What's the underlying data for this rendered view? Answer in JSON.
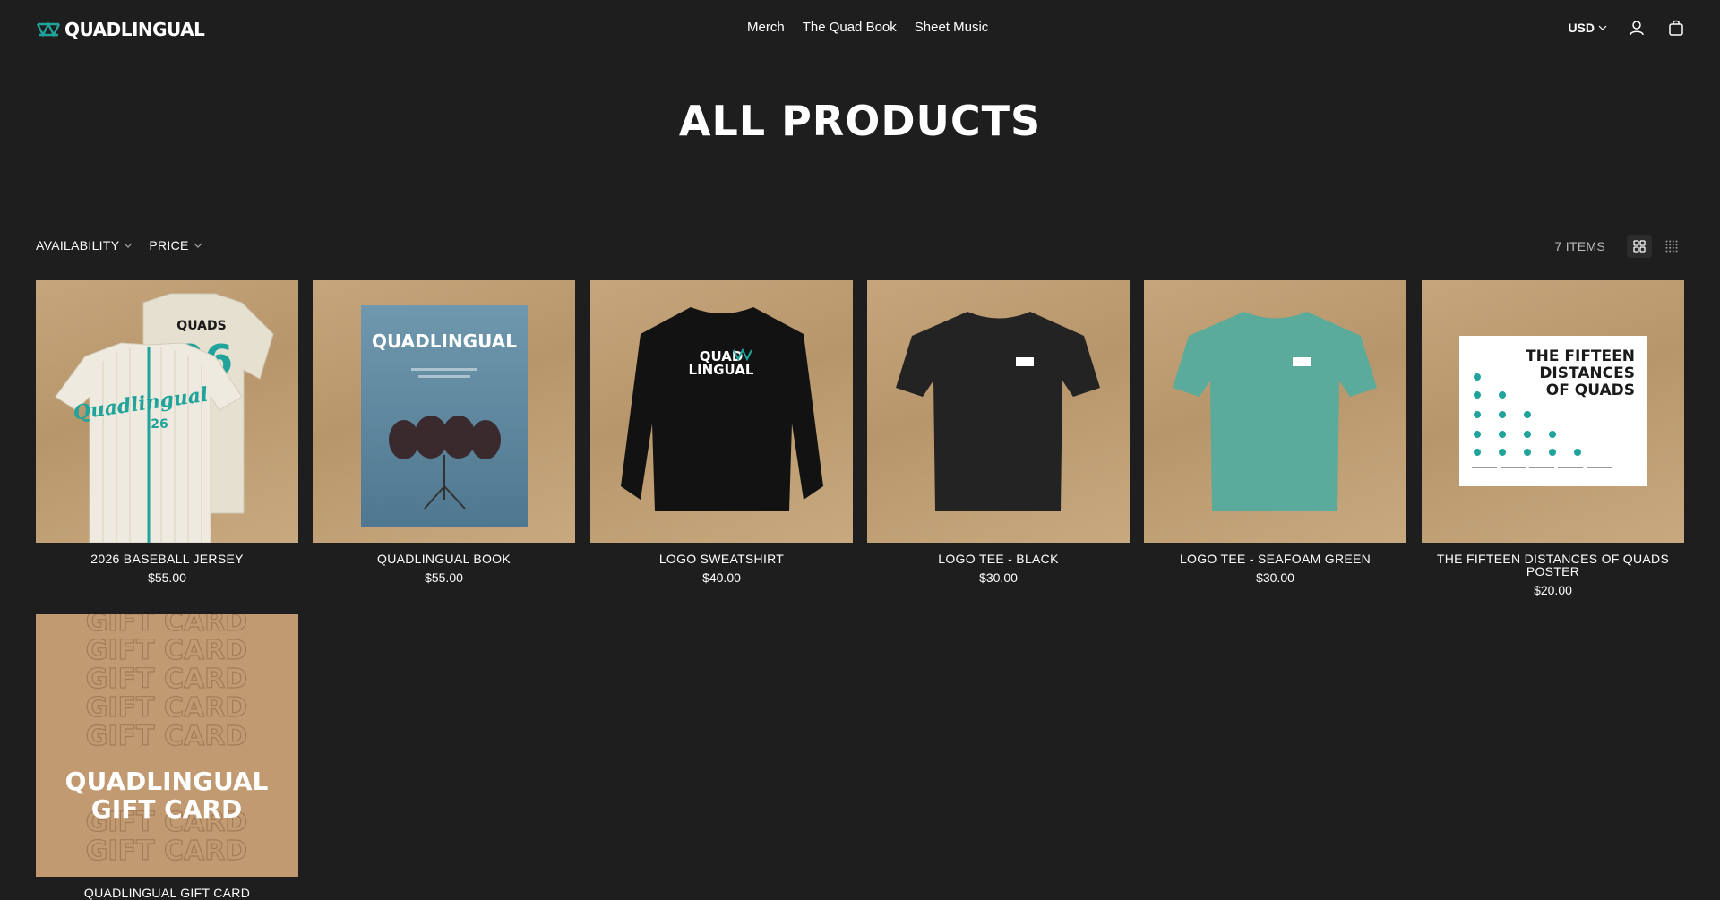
{
  "brand": {
    "name": "QUADLINGUAL",
    "accent": "#1fa39a"
  },
  "nav": [
    "Merch",
    "The Quad Book",
    "Sheet Music"
  ],
  "header": {
    "currency": "USD",
    "account_icon": "user-icon",
    "cart_icon": "bag-icon"
  },
  "page": {
    "title": "ALL PRODUCTS"
  },
  "filters": {
    "availability": "AVAILABILITY",
    "price": "PRICE"
  },
  "results": {
    "count": "7 ITEMS"
  },
  "products": [
    {
      "title": "2026 BASEBALL JERSEY",
      "price": "$55.00"
    },
    {
      "title": "QUADLINGUAL BOOK",
      "price": "$55.00"
    },
    {
      "title": "LOGO SWEATSHIRT",
      "price": "$40.00"
    },
    {
      "title": "LOGO TEE - BLACK",
      "price": "$30.00"
    },
    {
      "title": "LOGO TEE - SEAFOAM GREEN",
      "price": "$30.00"
    },
    {
      "title": "THE FIFTEEN DISTANCES OF QUADS POSTER",
      "price": "$20.00"
    },
    {
      "title": "QUADLINGUAL GIFT CARD",
      "price": ""
    }
  ],
  "product_art": {
    "jersey_front": "Quadlingual",
    "jersey_number": "26",
    "jersey_back_name": "QUADS",
    "book_cover_title": "QUADLINGUAL",
    "sweatshirt_logo": [
      "QUAD",
      "LINGUAL"
    ],
    "poster_title": [
      "THE FIFTEEN",
      "DISTANCES",
      "OF QUADS"
    ],
    "gift_card_pattern": "GIFT CARD",
    "gift_card_title": [
      "QUADLINGUAL",
      "GIFT CARD"
    ]
  }
}
